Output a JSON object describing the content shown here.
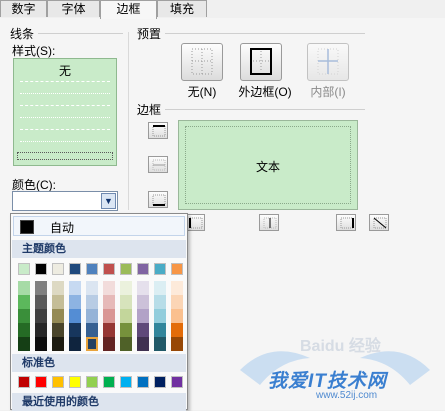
{
  "tabs": [
    {
      "label": "数字"
    },
    {
      "label": "字体"
    },
    {
      "label": "边框"
    },
    {
      "label": "填充"
    }
  ],
  "line": {
    "group_label": "线条",
    "style_label": "样式(S):",
    "style_none": "无",
    "color_label": "颜色(C):"
  },
  "presets": {
    "group_label": "预置",
    "none_label": "无(N)",
    "outline_label": "外边框(O)",
    "inside_label": "内部(I)"
  },
  "border": {
    "group_label": "边框",
    "preview_text": "文本"
  },
  "palette": {
    "auto_label": "自动",
    "theme_label": "主题颜色",
    "standard_label": "标准色",
    "recent_label": "最近使用的颜色",
    "theme_top": [
      "#c9ebc9",
      "#000000",
      "#eeece1",
      "#1f497d",
      "#4f81bd",
      "#c0504d",
      "#9bbb59",
      "#8064a2",
      "#4bacc6",
      "#f79646"
    ],
    "theme_shades": [
      [
        "#a6dba6",
        "#5cb85c",
        "#3a8f3a",
        "#256b25",
        "#153f15"
      ],
      [
        "#7f7f7f",
        "#595959",
        "#3f3f3f",
        "#262626",
        "#0c0c0c"
      ],
      [
        "#ddd9c3",
        "#c4bd97",
        "#948a54",
        "#4a452a",
        "#1d1b10"
      ],
      [
        "#c6d9f1",
        "#8db3e2",
        "#548dd4",
        "#17365d",
        "#0f243e"
      ],
      [
        "#dbe5f1",
        "#b8cce4",
        "#95b3d7",
        "#366092",
        "#244061"
      ],
      [
        "#f2dcdb",
        "#e6b9b8",
        "#d99694",
        "#953734",
        "#632423"
      ],
      [
        "#ebf1dd",
        "#d7e3bc",
        "#c3d69b",
        "#76923c",
        "#4f6128"
      ],
      [
        "#e5e0ec",
        "#ccc1d9",
        "#b2a2c7",
        "#5f497a",
        "#3f3151"
      ],
      [
        "#dbeef3",
        "#b7dde8",
        "#92cddc",
        "#31859b",
        "#205867"
      ],
      [
        "#fdeada",
        "#fbd5b5",
        "#fac08f",
        "#e36c09",
        "#974806"
      ]
    ],
    "standard": [
      "#c00000",
      "#ff0000",
      "#ffc000",
      "#ffff00",
      "#92d050",
      "#00b050",
      "#00b0f0",
      "#0070c0",
      "#002060",
      "#7030a0"
    ]
  },
  "watermark": {
    "brand": "我爱IT技术网",
    "url": "www.52ij.com",
    "baidu": "Baidu 经验"
  }
}
